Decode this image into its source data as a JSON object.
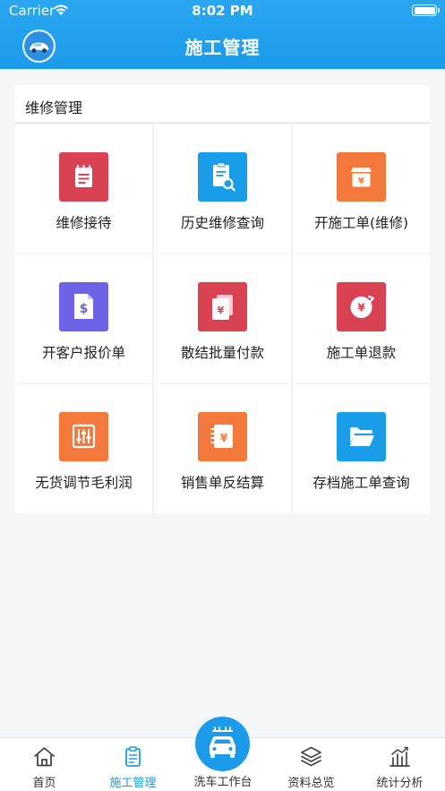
{
  "status_bar": {
    "carrier": "Carrier",
    "time": "8:02 PM"
  },
  "header": {
    "title": "施工管理",
    "avatar_icon": "car-avatar-icon"
  },
  "section": {
    "title": "维修管理",
    "items": [
      {
        "label": "维修接待",
        "icon": "notepad-icon",
        "color": "#d84253"
      },
      {
        "label": "历史维修查询",
        "icon": "document-search-icon",
        "color": "#1a9de8"
      },
      {
        "label": "开施工单(维修)",
        "icon": "yuan-box-icon",
        "color": "#f2793b"
      },
      {
        "label": "开客户报价单",
        "icon": "dollar-document-icon",
        "color": "#6e62e6"
      },
      {
        "label": "散结批量付款",
        "icon": "yuan-cards-icon",
        "color": "#d84253"
      },
      {
        "label": "施工单退款",
        "icon": "yuan-refund-icon",
        "color": "#d84253"
      },
      {
        "label": "无货调节毛利润",
        "icon": "sliders-icon",
        "color": "#f2793b"
      },
      {
        "label": "销售单反结算",
        "icon": "yuan-note-icon",
        "color": "#f2793b"
      },
      {
        "label": "存档施工单查询",
        "icon": "folder-icon",
        "color": "#1a9de8"
      }
    ]
  },
  "tabbar": {
    "accent": "#1c9bea",
    "home": "首页",
    "construction": "施工管理",
    "carwash": "洗车工作台",
    "data_overview": "资料总览",
    "statistics": "统计分析"
  }
}
